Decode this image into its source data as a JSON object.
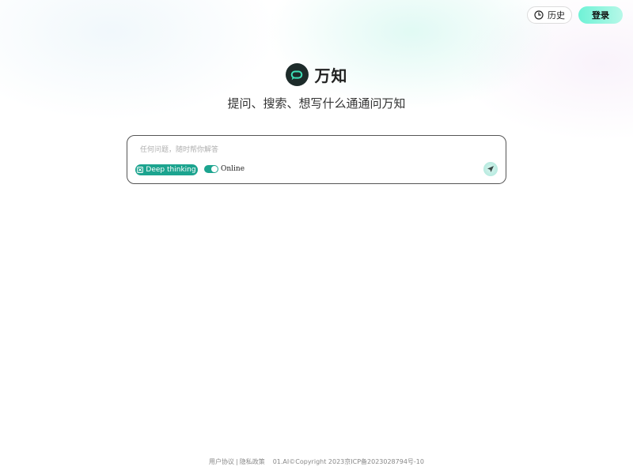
{
  "header": {
    "history_label": "历史",
    "login_label": "登录"
  },
  "brand": {
    "name": "万知",
    "tagline": "提问、搜索、想写什么通通问万知"
  },
  "chat": {
    "placeholder": "任何问题，随时帮你解答",
    "deep_thinking_label": "Deep thinking",
    "online_label": "Online",
    "online_enabled": true
  },
  "footer": {
    "user_agreement": "用户协议",
    "separator": "|",
    "privacy_policy": "隐私政策",
    "copyright": "01.AI©Copyright 2023京ICP备2023028794号-10"
  },
  "colors": {
    "accent": "#1ca48f",
    "login_gradient_start": "#6ff2d6",
    "logo_bg": "#1d2b2a"
  }
}
